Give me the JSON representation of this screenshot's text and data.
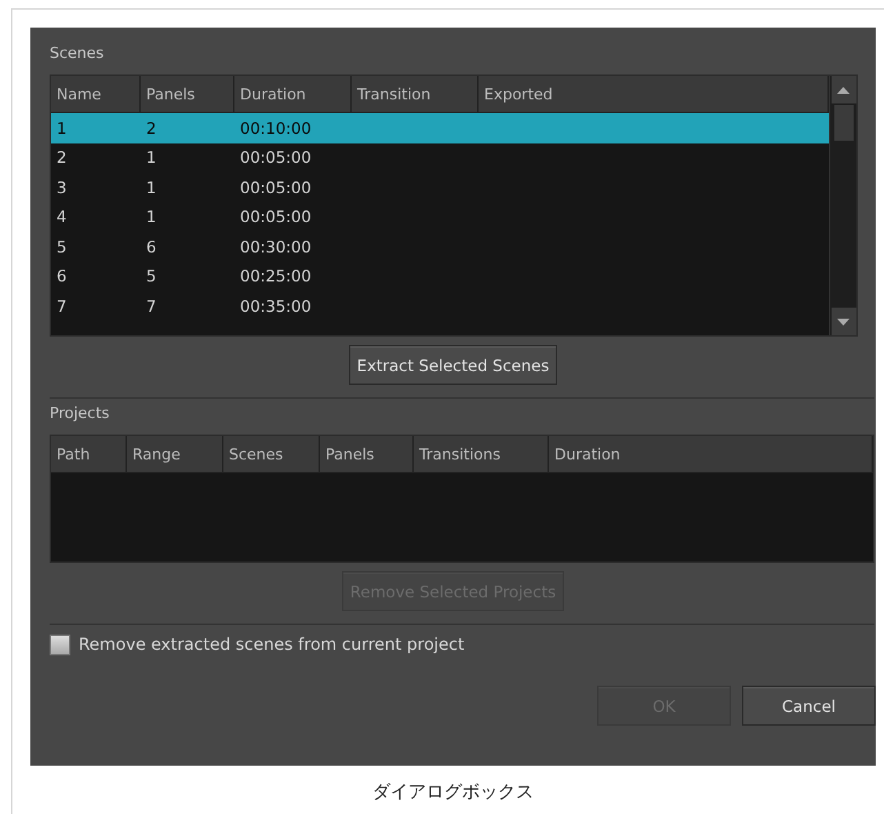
{
  "scenes": {
    "title": "Scenes",
    "columns": [
      "Name",
      "Panels",
      "Duration",
      "Transition",
      "Exported"
    ],
    "rows": [
      {
        "cells": [
          "1",
          "2",
          "00:10:00",
          "",
          ""
        ],
        "selected": true
      },
      {
        "cells": [
          "2",
          "1",
          "00:05:00",
          "",
          ""
        ],
        "selected": false
      },
      {
        "cells": [
          "3",
          "1",
          "00:05:00",
          "",
          ""
        ],
        "selected": false
      },
      {
        "cells": [
          "4",
          "1",
          "00:05:00",
          "",
          ""
        ],
        "selected": false
      },
      {
        "cells": [
          "5",
          "6",
          "00:30:00",
          "",
          ""
        ],
        "selected": false
      },
      {
        "cells": [
          "6",
          "5",
          "00:25:00",
          "",
          ""
        ],
        "selected": false
      },
      {
        "cells": [
          "7",
          "7",
          "00:35:00",
          "",
          ""
        ],
        "selected": false
      }
    ],
    "button": {
      "label": "Extract Selected Scenes",
      "disabled": false
    }
  },
  "projects": {
    "title": "Projects",
    "columns": [
      "Path",
      "Range",
      "Scenes",
      "Panels",
      "Transitions",
      "Duration"
    ],
    "button": {
      "label": "Remove Selected Projects",
      "disabled": true
    }
  },
  "option": {
    "label": "Remove extracted scenes from current project",
    "checked": false
  },
  "buttons": [
    {
      "label": "OK",
      "disabled": true
    },
    {
      "label": "Cancel",
      "disabled": false
    }
  ],
  "caption": "ダイアログボックス"
}
